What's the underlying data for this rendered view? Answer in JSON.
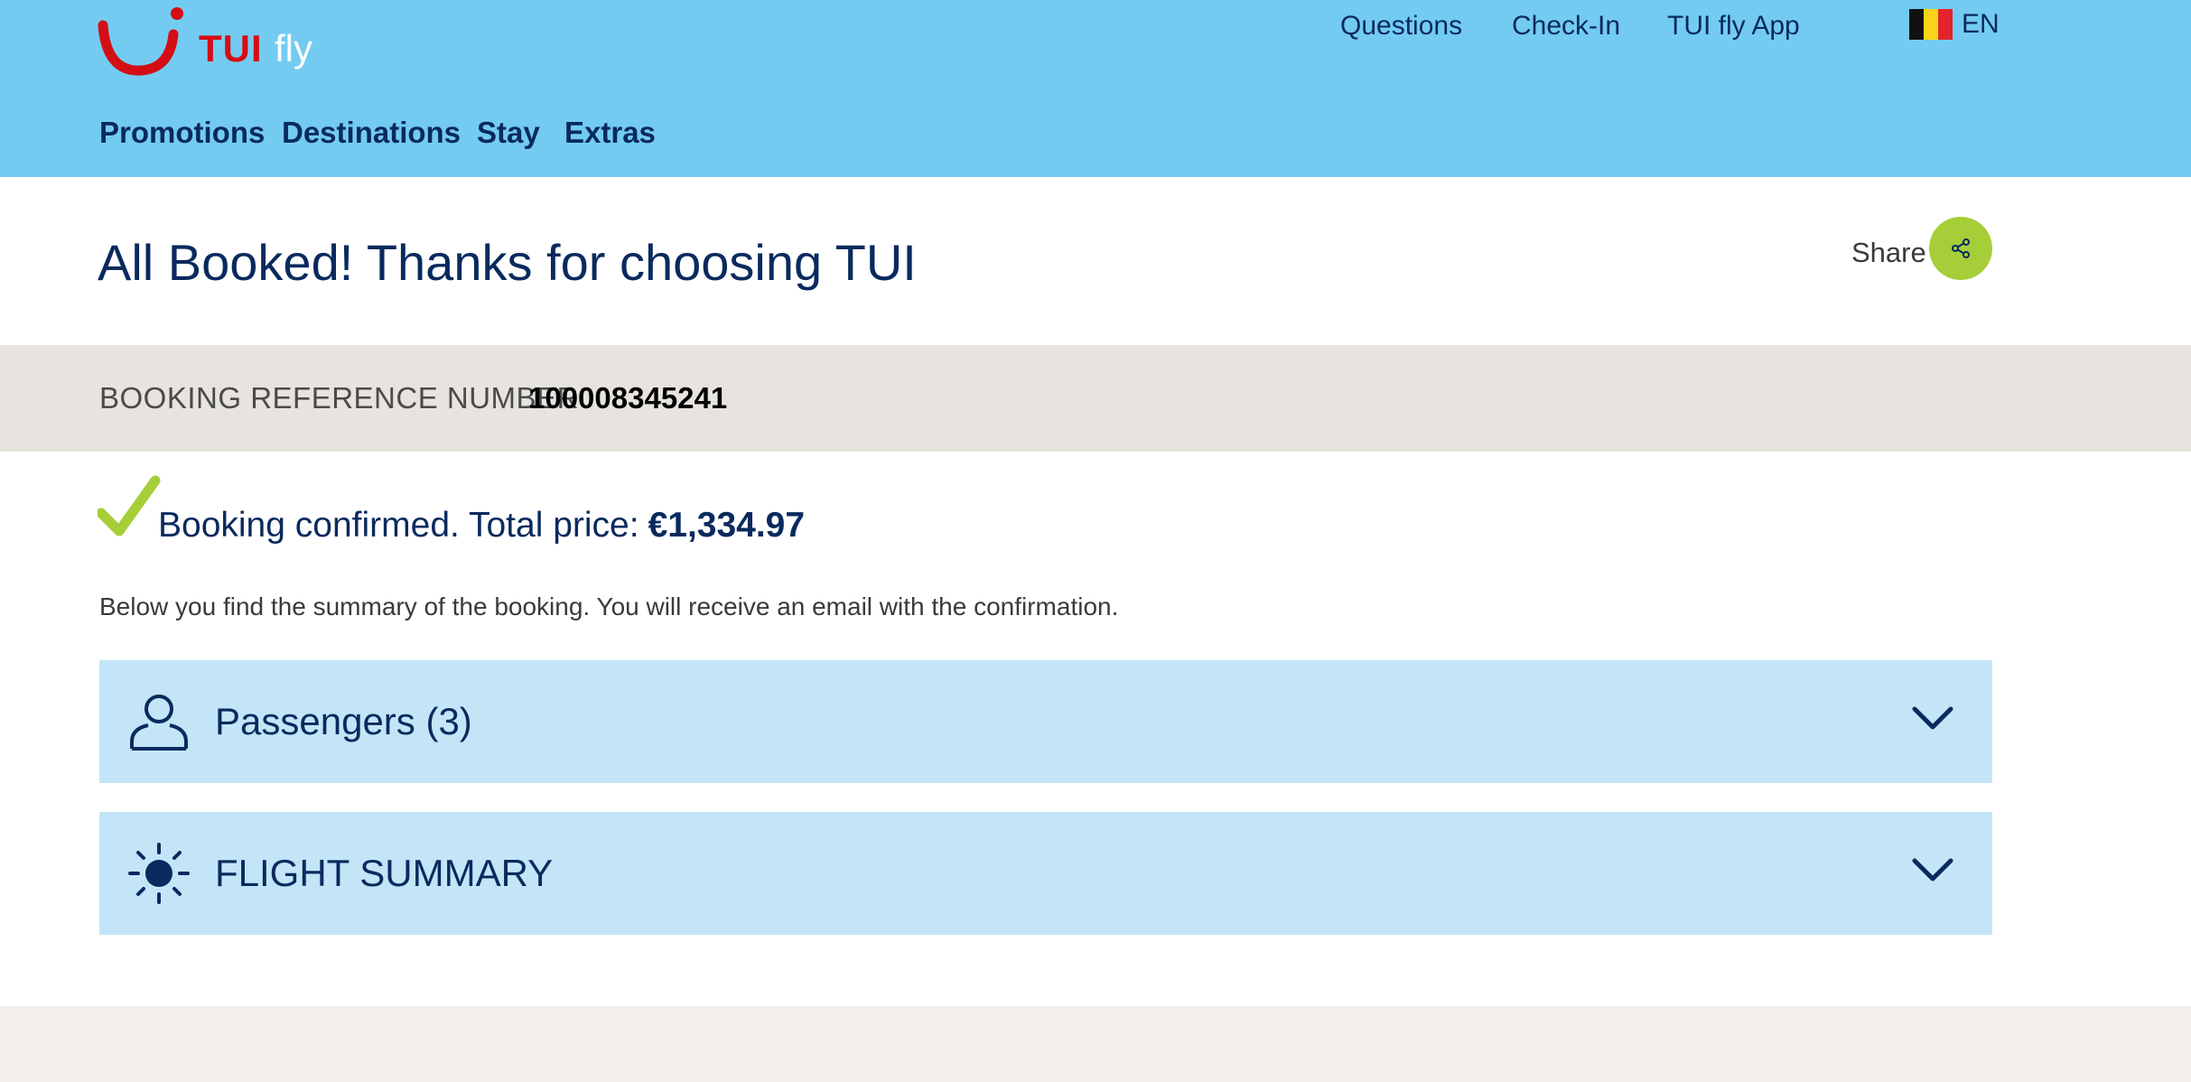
{
  "header": {
    "logo": {
      "brand": "TUI",
      "product": "fly",
      "colors": {
        "brand_red": "#d40e14"
      }
    },
    "top_links": [
      {
        "label": "Questions"
      },
      {
        "label": "Check-In"
      },
      {
        "label": "TUI fly App"
      }
    ],
    "language": {
      "flag": "belgium-flag",
      "code": "EN"
    },
    "main_nav": [
      {
        "label": "Promotions"
      },
      {
        "label": "Destinations"
      },
      {
        "label": "Stay"
      },
      {
        "label": "Extras"
      }
    ],
    "background_color": "#73cbf2"
  },
  "page": {
    "title": "All Booked! Thanks for choosing TUI",
    "share": {
      "label": "Share",
      "icon": "share-icon",
      "color": "#a6ce39"
    }
  },
  "booking_reference": {
    "label": "BOOKING REFERENCE NUMBER",
    "number": "100008345241"
  },
  "confirmation": {
    "icon": "checkmark-icon",
    "text": "Booking confirmed. Total price:",
    "price": "€1,334.97",
    "summary": "Below you find the summary of the booking. You will receive an email with the confirmation."
  },
  "panels": [
    {
      "label": "Passengers (3)",
      "icon": "person-icon",
      "expanded": false
    },
    {
      "label": "FLIGHT SUMMARY",
      "icon": "sun-icon",
      "expanded": false
    }
  ],
  "colors": {
    "navy": "#092a5e",
    "panel_bg": "#c3e5f7",
    "ref_band_bg": "#e7e3df",
    "check_green": "#a6ce39"
  }
}
